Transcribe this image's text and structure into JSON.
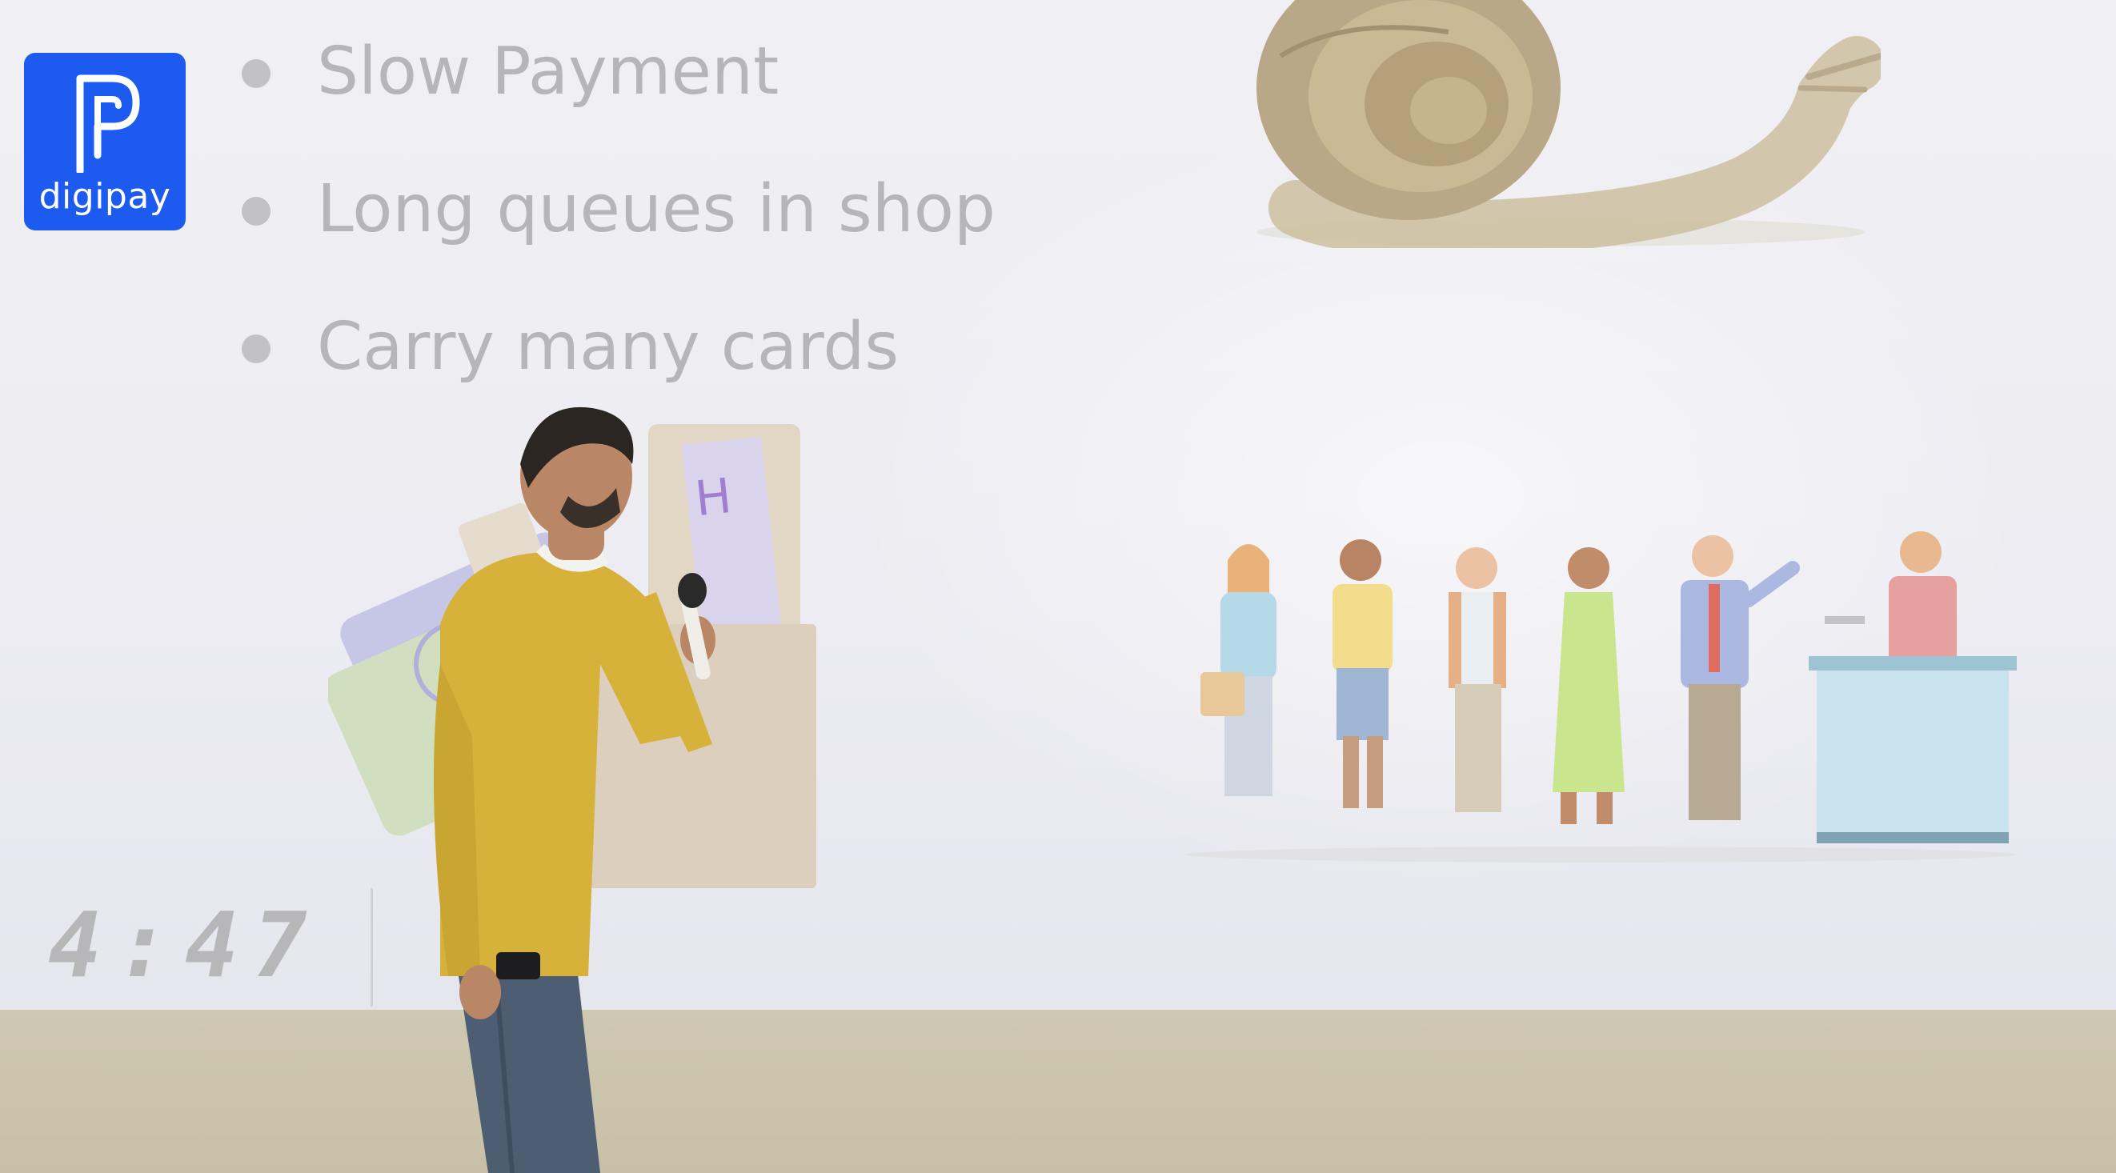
{
  "logo": {
    "text": "digipay",
    "color": "#1d5bf0"
  },
  "bullets": [
    {
      "label": "Slow Payment"
    },
    {
      "label": "Long queues in shop"
    },
    {
      "label": "Carry many cards"
    }
  ],
  "timer": {
    "text": "4:47"
  },
  "illustrations": [
    "snail-illustration",
    "cards-wallet-illustration",
    "shop-queue-illustration"
  ],
  "colors": {
    "slide_text": "#b6b6b9",
    "sweater": "#d7b23b",
    "jeans": "#4d5d72"
  }
}
